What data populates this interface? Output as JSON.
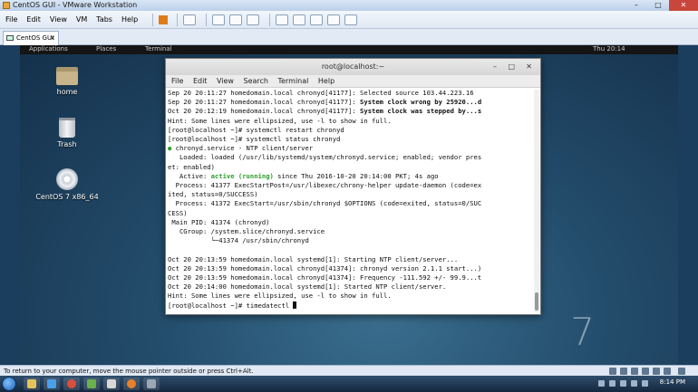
{
  "vmware": {
    "title": "CentOS GUI - VMware Workstation",
    "menu": [
      "File",
      "Edit",
      "View",
      "VM",
      "Tabs",
      "Help"
    ],
    "tab_label": "CentOS GUI",
    "status_text": "To return to your computer, move the mouse pointer outside or press Ctrl+Alt."
  },
  "guest": {
    "topbar": {
      "applications": "Applications",
      "places": "Places",
      "terminal": "Terminal",
      "clock": "Thu 20:14"
    },
    "desktop_icons": [
      "home",
      "Trash",
      "CentOS 7 x86_64"
    ],
    "logo_numeral": "7"
  },
  "terminal": {
    "title": "root@localhost:~",
    "menu": [
      "File",
      "Edit",
      "View",
      "Search",
      "Terminal",
      "Help"
    ],
    "lines": [
      "Sep 20 20:11:27 homedomain.local chronyd[41177]: Selected source 103.44.223.16",
      "Sep 20 20:11:27 homedomain.local chronyd[41177]: System clock wrong by 25920...d",
      "Oct 20 20:12:19 homedomain.local chronyd[41177]: System clock was stepped by...s",
      "Hint: Some lines were ellipsized, use -l to show in full.",
      "[root@localhost ~]# systemctl restart chronyd",
      "[root@localhost ~]# systemctl status chronyd",
      "● chronyd.service - NTP client/server",
      "   Loaded: loaded (/usr/lib/systemd/system/chronyd.service; enabled; vendor pres",
      "et: enabled)",
      "   Active: active (running) since Thu 2016-10-20 20:14:00 PKT; 4s ago",
      "  Process: 41377 ExecStartPost=/usr/libexec/chrony-helper update-daemon (code=ex",
      "ited, status=0/SUCCESS)",
      "  Process: 41372 ExecStart=/usr/sbin/chronyd $OPTIONS (code=exited, status=0/SUC",
      "CESS)",
      " Main PID: 41374 (chronyd)",
      "   CGroup: /system.slice/chronyd.service",
      "           └─41374 /usr/sbin/chronyd",
      "",
      "Oct 20 20:13:59 homedomain.local systemd[1]: Starting NTP client/server...",
      "Oct 20 20:13:59 homedomain.local chronyd[41374]: chronyd version 2.1.1 start...)",
      "Oct 20 20:13:59 homedomain.local chronyd[41374]: Frequency -111.592 +/- 99.9...t",
      "Oct 20 20:14:00 homedomain.local systemd[1]: Started NTP client/server.",
      "Hint: Some lines were ellipsized, use -l to show in full.",
      "[root@localhost ~]# timedatectl "
    ]
  },
  "host_taskbar": {
    "clock": "8:14 PM"
  }
}
